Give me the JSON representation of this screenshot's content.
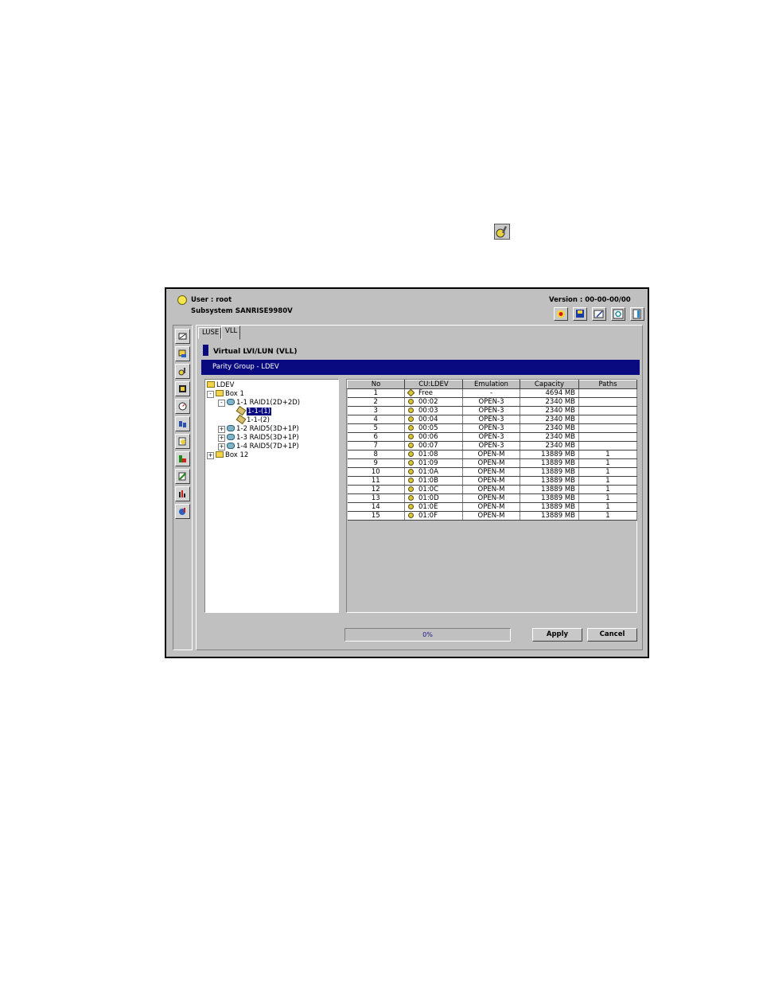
{
  "floating_icon": "settings-wrench-icon",
  "header": {
    "user_label": "User : root",
    "subsystem_label": "Subsystem :",
    "subsystem_value": "SANRISE9980V",
    "version_label": "Version : 00-00-00/00",
    "toolbar_icons": [
      "alert-icon",
      "save-icon",
      "edit-icon",
      "refresh-icon",
      "exit-icon"
    ]
  },
  "sidebar_icons": [
    "map-icon",
    "box-icon",
    "settings-icon",
    "list-icon",
    "gauge-icon",
    "users-icon",
    "edit-doc-icon",
    "chart-icon",
    "tool-icon",
    "bar-chart-icon",
    "globe-icon"
  ],
  "tabs": [
    {
      "label": "LUSE",
      "active": false
    },
    {
      "label": "VLL",
      "active": true
    }
  ],
  "panel_title": "Virtual LVI/LUN (VLL)",
  "group_bar": "Parity Group - LDEV",
  "tree": [
    {
      "label": "LDEV",
      "icon": "folder-icon"
    },
    {
      "label": "Box 1",
      "icon": "folder-icon",
      "expander": "-"
    },
    {
      "label": "1-1 RAID1(2D+2D)",
      "icon": "parity-group-icon",
      "expander": "-"
    },
    {
      "label": "1-1-(1)",
      "icon": "ldev-icon",
      "selected": true
    },
    {
      "label": "1-1-(2)",
      "icon": "ldev-icon"
    },
    {
      "label": "1-2 RAID5(3D+1P)",
      "icon": "parity-group-icon",
      "expander": "+"
    },
    {
      "label": "1-3 RAID5(3D+1P)",
      "icon": "parity-group-icon",
      "expander": "+"
    },
    {
      "label": "1-4 RAID5(7D+1P)",
      "icon": "parity-group-icon",
      "expander": "+"
    },
    {
      "label": "Box 12",
      "icon": "folder-icon",
      "expander": "+"
    }
  ],
  "table": {
    "columns": [
      "No",
      "CU:LDEV",
      "Emulation",
      "Capacity",
      "Paths"
    ],
    "rows": [
      [
        "1",
        "Free",
        "-",
        "4694 MB",
        ""
      ],
      [
        "2",
        "00:02",
        "OPEN-3",
        "2340 MB",
        ""
      ],
      [
        "3",
        "00:03",
        "OPEN-3",
        "2340 MB",
        ""
      ],
      [
        "4",
        "00:04",
        "OPEN-3",
        "2340 MB",
        ""
      ],
      [
        "5",
        "00:05",
        "OPEN-3",
        "2340 MB",
        ""
      ],
      [
        "6",
        "00:06",
        "OPEN-3",
        "2340 MB",
        ""
      ],
      [
        "7",
        "00:07",
        "OPEN-3",
        "2340 MB",
        ""
      ],
      [
        "8",
        "01:08",
        "OPEN-M",
        "13889 MB",
        "1"
      ],
      [
        "9",
        "01:09",
        "OPEN-M",
        "13889 MB",
        "1"
      ],
      [
        "10",
        "01:0A",
        "OPEN-M",
        "13889 MB",
        "1"
      ],
      [
        "11",
        "01:0B",
        "OPEN-M",
        "13889 MB",
        "1"
      ],
      [
        "12",
        "01:0C",
        "OPEN-M",
        "13889 MB",
        "1"
      ],
      [
        "13",
        "01:0D",
        "OPEN-M",
        "13889 MB",
        "1"
      ],
      [
        "14",
        "01:0E",
        "OPEN-M",
        "13889 MB",
        "1"
      ],
      [
        "15",
        "01:0F",
        "OPEN-M",
        "13889 MB",
        "1"
      ]
    ]
  },
  "progress": {
    "label": "0%",
    "value": 0
  },
  "buttons": {
    "apply": "Apply",
    "cancel": "Cancel"
  },
  "colors": {
    "window_bg": "#c0c0c0",
    "accent": "#0a0a80",
    "selection": "#0a0a80"
  }
}
